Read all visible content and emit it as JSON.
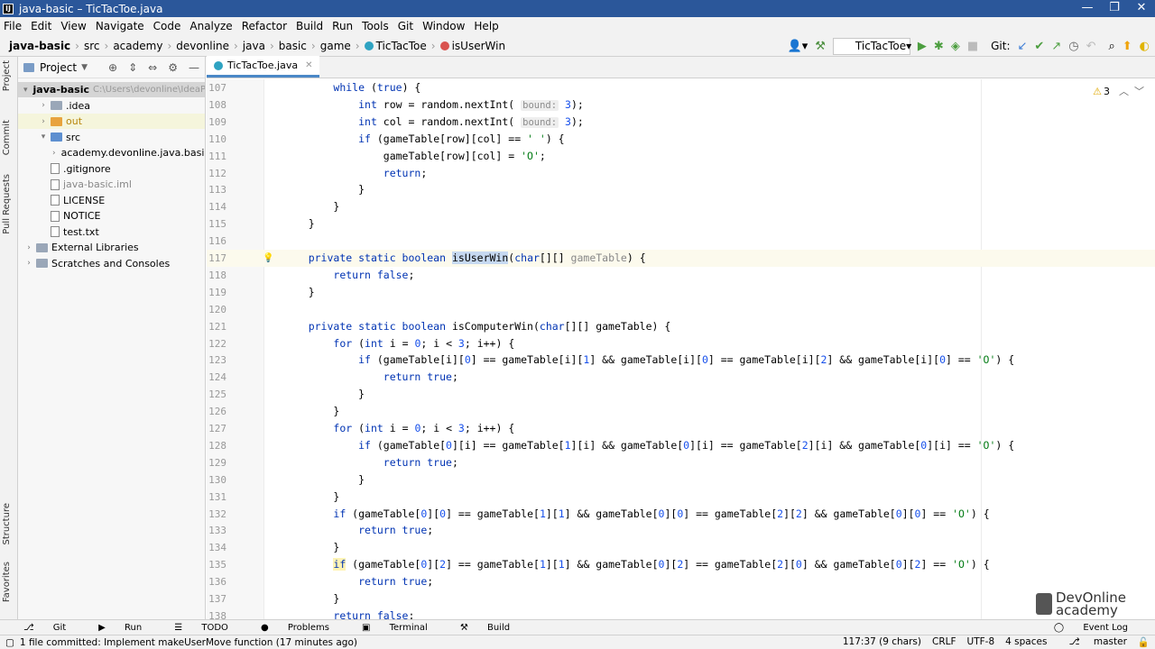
{
  "window": {
    "title": "java-basic – TicTacToe.java"
  },
  "menu": [
    "File",
    "Edit",
    "View",
    "Navigate",
    "Code",
    "Analyze",
    "Refactor",
    "Build",
    "Run",
    "Tools",
    "Git",
    "Window",
    "Help"
  ],
  "breadcrumb": [
    "java-basic",
    "src",
    "academy",
    "devonline",
    "java",
    "basic",
    "game",
    "TicTacToe",
    "isUserWin"
  ],
  "toolbar": {
    "run_config": "TicTacToe",
    "git_label": "Git:"
  },
  "project": {
    "title": "Project",
    "tree": [
      {
        "label": "java-basic",
        "extra": "C:\\Users\\devonline\\IdeaPro",
        "depth": 0,
        "arrow": "▾",
        "kind": "root"
      },
      {
        "label": ".idea",
        "depth": 1,
        "arrow": "›",
        "kind": "folder"
      },
      {
        "label": "out",
        "depth": 1,
        "arrow": "›",
        "kind": "folder-excl"
      },
      {
        "label": "src",
        "depth": 1,
        "arrow": "▾",
        "kind": "folder-src"
      },
      {
        "label": "academy.devonline.java.basic",
        "depth": 2,
        "arrow": "›",
        "kind": "package"
      },
      {
        "label": ".gitignore",
        "depth": 1,
        "arrow": "",
        "kind": "file"
      },
      {
        "label": "java-basic.iml",
        "depth": 1,
        "arrow": "",
        "kind": "file-grey"
      },
      {
        "label": "LICENSE",
        "depth": 1,
        "arrow": "",
        "kind": "file"
      },
      {
        "label": "NOTICE",
        "depth": 1,
        "arrow": "",
        "kind": "file"
      },
      {
        "label": "test.txt",
        "depth": 1,
        "arrow": "",
        "kind": "file"
      },
      {
        "label": "External Libraries",
        "depth": 0,
        "arrow": "›",
        "kind": "lib"
      },
      {
        "label": "Scratches and Consoles",
        "depth": 0,
        "arrow": "›",
        "kind": "scratch"
      }
    ]
  },
  "left_tabs": [
    "Project",
    "Commit",
    "Pull Requests",
    "Structure",
    "Favorites"
  ],
  "editor": {
    "tab": "TicTacToe.java",
    "warnings": "3",
    "lines": [
      {
        "n": "107",
        "html": "        <span class=\"kw\">while</span> (<span class=\"kw\">true</span>) {"
      },
      {
        "n": "108",
        "html": "            <span class=\"kw\">int</span> row = random.nextInt( <span class=\"hint\">bound:</span> <span class=\"num\">3</span>);"
      },
      {
        "n": "109",
        "html": "            <span class=\"kw\">int</span> col = random.nextInt( <span class=\"hint\">bound:</span> <span class=\"num\">3</span>);"
      },
      {
        "n": "110",
        "html": "            <span class=\"kw\">if</span> (gameTable[row][col] == <span class=\"str\">' '</span>) {"
      },
      {
        "n": "111",
        "html": "                gameTable[row][col] = <span class=\"str\">'O'</span>;"
      },
      {
        "n": "112",
        "html": "                <span class=\"kw\">return</span>;"
      },
      {
        "n": "113",
        "html": "            }"
      },
      {
        "n": "114",
        "html": "        }"
      },
      {
        "n": "115",
        "html": "    }"
      },
      {
        "n": "116",
        "html": ""
      },
      {
        "n": "117",
        "html": "    <span class=\"kw\">private static boolean</span> <span class=\"selw\">isUserWin</span>(<span class=\"kw\">char</span>[][] <span class=\"param\">gameTable</span>) {"
      },
      {
        "n": "118",
        "html": "        <span class=\"kw\">return false</span>;"
      },
      {
        "n": "119",
        "html": "    }"
      },
      {
        "n": "120",
        "html": ""
      },
      {
        "n": "121",
        "html": "    <span class=\"kw\">private static boolean</span> isComputerWin(<span class=\"kw\">char</span>[][] gameTable) {"
      },
      {
        "n": "122",
        "html": "        <span class=\"kw\">for</span> (<span class=\"kw\">int</span> i = <span class=\"num\">0</span>; i &lt; <span class=\"num\">3</span>; i++) {"
      },
      {
        "n": "123",
        "html": "            <span class=\"kw\">if</span> (gameTable[i][<span class=\"num\">0</span>] == gameTable[i][<span class=\"num\">1</span>] &amp;&amp; gameTable[i][<span class=\"num\">0</span>] == gameTable[i][<span class=\"num\">2</span>] &amp;&amp; gameTable[i][<span class=\"num\">0</span>] == <span class=\"str\">'O'</span>) {"
      },
      {
        "n": "124",
        "html": "                <span class=\"kw\">return true</span>;"
      },
      {
        "n": "125",
        "html": "            }"
      },
      {
        "n": "126",
        "html": "        }"
      },
      {
        "n": "127",
        "html": "        <span class=\"kw\">for</span> (<span class=\"kw\">int</span> i = <span class=\"num\">0</span>; i &lt; <span class=\"num\">3</span>; i++) {"
      },
      {
        "n": "128",
        "html": "            <span class=\"kw\">if</span> (gameTable[<span class=\"num\">0</span>][i] == gameTable[<span class=\"num\">1</span>][i] &amp;&amp; gameTable[<span class=\"num\">0</span>][i] == gameTable[<span class=\"num\">2</span>][i] &amp;&amp; gameTable[<span class=\"num\">0</span>][i] == <span class=\"str\">'O'</span>) {"
      },
      {
        "n": "129",
        "html": "                <span class=\"kw\">return true</span>;"
      },
      {
        "n": "130",
        "html": "            }"
      },
      {
        "n": "131",
        "html": "        }"
      },
      {
        "n": "132",
        "html": "        <span class=\"kw\">if</span> (gameTable[<span class=\"num\">0</span>][<span class=\"num\">0</span>] == gameTable[<span class=\"num\">1</span>][<span class=\"num\">1</span>] &amp;&amp; gameTable[<span class=\"num\">0</span>][<span class=\"num\">0</span>] == gameTable[<span class=\"num\">2</span>][<span class=\"num\">2</span>] &amp;&amp; gameTable[<span class=\"num\">0</span>][<span class=\"num\">0</span>] == <span class=\"str\">'O'</span>) {"
      },
      {
        "n": "133",
        "html": "            <span class=\"kw\">return true</span>;"
      },
      {
        "n": "134",
        "html": "        }"
      },
      {
        "n": "135",
        "html": "        <span class=\"kw mark\">if</span> (gameTable[<span class=\"num\">0</span>][<span class=\"num\">2</span>] == gameTable[<span class=\"num\">1</span>][<span class=\"num\">1</span>] &amp;&amp; gameTable[<span class=\"num\">0</span>][<span class=\"num\">2</span>] == gameTable[<span class=\"num\">2</span>][<span class=\"num\">0</span>] &amp;&amp; gameTable[<span class=\"num\">0</span>][<span class=\"num\">2</span>] == <span class=\"str\">'O'</span>) {"
      },
      {
        "n": "136",
        "html": "            <span class=\"kw\">return true</span>;"
      },
      {
        "n": "137",
        "html": "        }"
      },
      {
        "n": "138",
        "html": "        <span class=\"kw\">return false</span>;"
      }
    ]
  },
  "logo": {
    "line1": "DevOnline",
    "line2": "academy"
  },
  "tool_windows": [
    "Git",
    "Run",
    "TODO",
    "Problems",
    "Terminal",
    "Build"
  ],
  "event_log": "Event Log",
  "status": {
    "message": "1 file committed: Implement makeUserMove function (17 minutes ago)",
    "position": "117:37 (9 chars)",
    "line_sep": "CRLF",
    "encoding": "UTF-8",
    "indent": "4 spaces",
    "branch": "master"
  },
  "colors": {
    "title_bg": "#2b579a",
    "keyword": "#0033b3",
    "string": "#067d17",
    "number": "#1750eb"
  }
}
